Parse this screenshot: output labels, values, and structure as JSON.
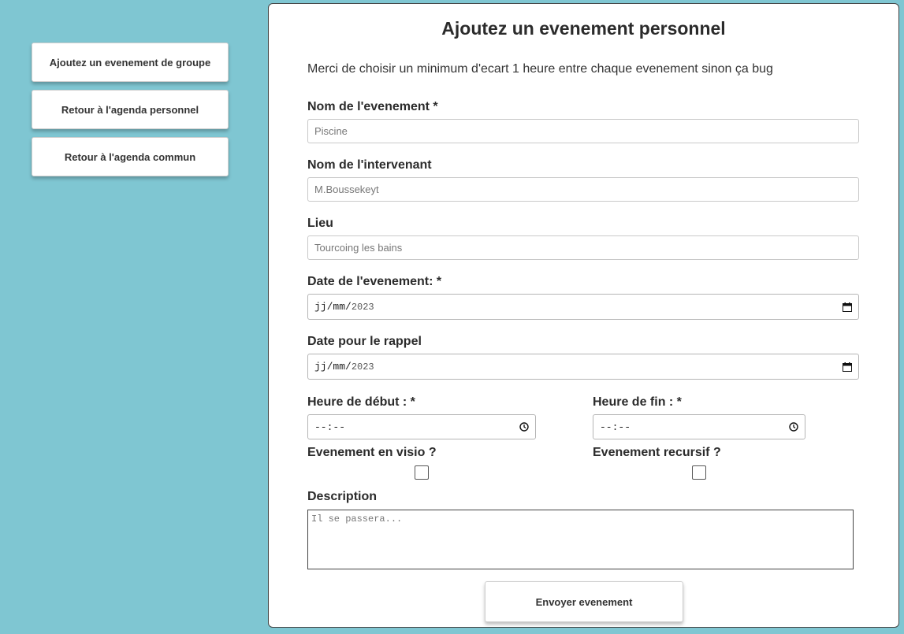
{
  "sidebar": {
    "buttons": [
      {
        "label": "Ajoutez un evenement de groupe"
      },
      {
        "label": "Retour à l'agenda personnel"
      },
      {
        "label": "Retour à l'agenda commun"
      }
    ]
  },
  "form": {
    "title": "Ajoutez un evenement personnel",
    "notice": "Merci de choisir un minimum d'ecart 1 heure entre chaque evenement sinon ça bug",
    "event_name": {
      "label": "Nom de l'evenement *",
      "placeholder": "Piscine",
      "value": ""
    },
    "speaker": {
      "label": "Nom de l'intervenant",
      "placeholder": "M.Boussekeyt",
      "value": ""
    },
    "place": {
      "label": "Lieu",
      "placeholder": "Tourcoing les bains",
      "value": ""
    },
    "event_date": {
      "label": "Date de l'evenement: *",
      "day_month": "jj/mm/",
      "year": "2023"
    },
    "reminder_date": {
      "label": "Date pour le rappel",
      "day_month": "jj/mm/",
      "year": "2023"
    },
    "start_time": {
      "label": "Heure de début : *",
      "value": "--:--"
    },
    "end_time": {
      "label": "Heure de fin : *",
      "value": "--:--"
    },
    "visio": {
      "label": "Evenement en visio ?",
      "checked": false
    },
    "recursive": {
      "label": "Evenement recursif ?",
      "checked": false
    },
    "description": {
      "label": "Description",
      "placeholder": "Il se passera..."
    },
    "submit_label": "Envoyer evenement"
  },
  "colors": {
    "background": "#7fc6d2",
    "panel": "#ffffff"
  },
  "icons": [
    "calendar-icon",
    "clock-icon"
  ]
}
